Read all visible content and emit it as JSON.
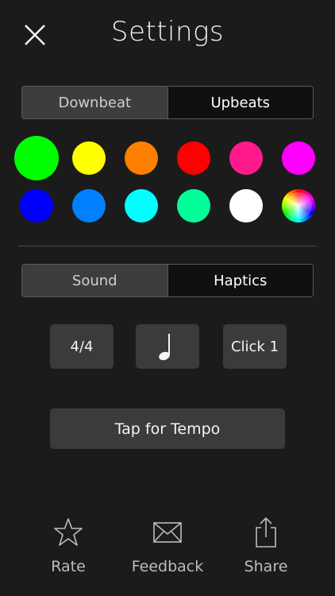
{
  "header": {
    "title": "Settings"
  },
  "beat_segment": {
    "options": [
      "Downbeat",
      "Upbeats"
    ],
    "selected": "Downbeat"
  },
  "colors": {
    "row1": [
      "#00ff00",
      "#ffff00",
      "#ff8000",
      "#ff0000",
      "#ff1a8c",
      "#ff00ff"
    ],
    "row2": [
      "#0000ff",
      "#0080ff",
      "#00ffff",
      "#00ff99",
      "#ffffff",
      "rainbow"
    ],
    "selected": "#00ff00"
  },
  "output_segment": {
    "options": [
      "Sound",
      "Haptics"
    ],
    "selected": "Sound"
  },
  "tiles": {
    "time_signature": "4/4",
    "note_value_icon": "quarter-note-icon",
    "click_sound": "Click 1"
  },
  "tempo_button": {
    "label": "Tap for Tempo"
  },
  "bottom_bar": {
    "items": [
      {
        "label": "Rate",
        "icon": "star-icon"
      },
      {
        "label": "Feedback",
        "icon": "envelope-icon"
      },
      {
        "label": "Share",
        "icon": "share-icon"
      }
    ]
  }
}
